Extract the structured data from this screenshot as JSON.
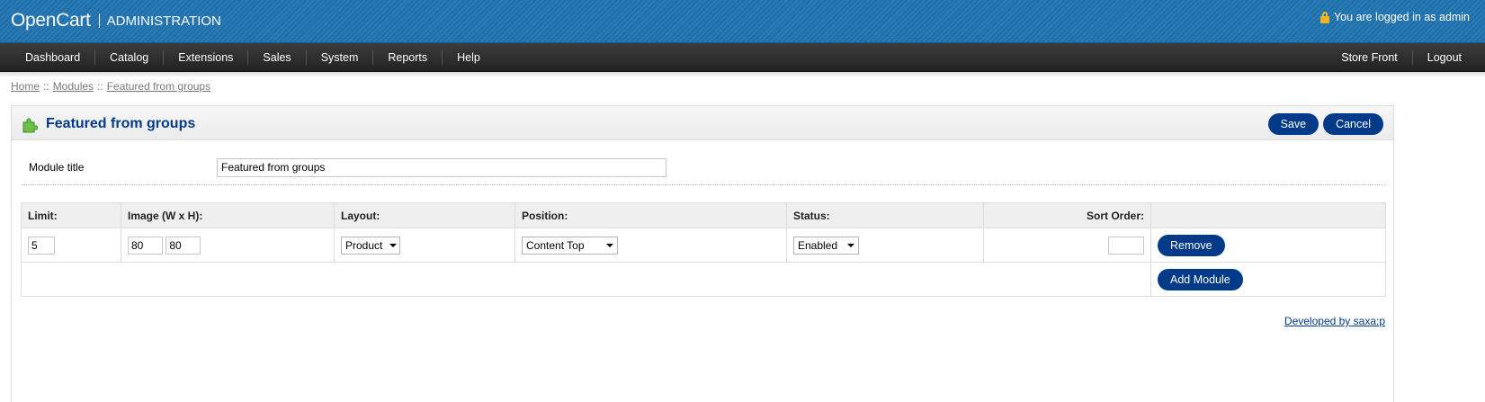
{
  "header": {
    "brand": "OpenCart",
    "section": "ADMINISTRATION",
    "logged_in": "You are logged in as admin"
  },
  "menu": {
    "left": [
      "Dashboard",
      "Catalog",
      "Extensions",
      "Sales",
      "System",
      "Reports",
      "Help"
    ],
    "right": [
      "Store Front",
      "Logout"
    ]
  },
  "breadcrumb": {
    "home": "Home",
    "modules": "Modules",
    "current": "Featured from groups",
    "separator": "::"
  },
  "box": {
    "title": "Featured from groups",
    "save": "Save",
    "cancel": "Cancel",
    "module_title_label": "Module title",
    "module_title_value": "Featured from groups"
  },
  "table": {
    "headers": {
      "limit": "Limit:",
      "image": "Image (W x H):",
      "layout": "Layout:",
      "position": "Position:",
      "status": "Status:",
      "sort_order": "Sort Order:"
    },
    "row": {
      "limit": "5",
      "width": "80",
      "height": "80",
      "layout": "Product",
      "position": "Content Top",
      "status": "Enabled",
      "sort_order": "",
      "remove": "Remove"
    },
    "add_module": "Add Module"
  },
  "footer": {
    "developed_by": "Developed by saxa:p"
  },
  "colors": {
    "header_blue": "#2a7bb6",
    "button_blue": "#003a88",
    "menu_dark": "#2c2c2c"
  }
}
